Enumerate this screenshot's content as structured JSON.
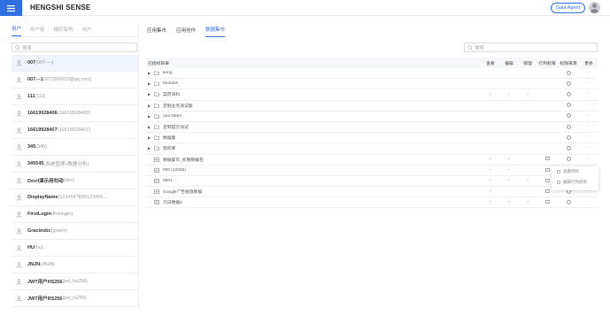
{
  "header": {
    "brand": "HENGSHI SENSE",
    "agent_button": "Data Agent",
    "menu_icon": "hamburger-menu-icon",
    "avatar_icon": "user-avatar-icon"
  },
  "left_panel": {
    "tabs": [
      {
        "label": "用户",
        "active": true
      },
      {
        "label": "用户组",
        "active": false
      },
      {
        "label": "组织架构",
        "active": false
      },
      {
        "label": "用户",
        "active": false
      }
    ],
    "search_placeholder": "搜索",
    "users": [
      {
        "name": "007",
        "id": "(007----)",
        "selected": true
      },
      {
        "name": "007---1",
        "id": "(977399912@qq.com)",
        "selected": false
      },
      {
        "name": "111",
        "id": "(111)",
        "selected": false
      },
      {
        "name": "16619928406",
        "id": "(16619928406)",
        "selected": false
      },
      {
        "name": "16619928407",
        "id": "(16619928407)",
        "selected": false
      },
      {
        "name": "345",
        "id": "(345)",
        "selected": false
      },
      {
        "name": "345545",
        "id": "(系统管理+数据分析)",
        "selected": false
      },
      {
        "name": "Devil演示用勿动",
        "id": "(dev)",
        "selected": false
      },
      {
        "name": "DisplayName",
        "id": "(1234567890123456…",
        "selected": false
      },
      {
        "name": "FirstLogin",
        "id": "(firstlogin)",
        "selected": false
      },
      {
        "name": "Graciesbc",
        "id": "(gracie)",
        "selected": false
      },
      {
        "name": "HU",
        "id": "(hu)",
        "selected": false
      },
      {
        "name": "JNJN",
        "id": "(JNJN)",
        "selected": false
      },
      {
        "name": "JWT用户HS256",
        "id": "(jwt_hs256)",
        "selected": false
      },
      {
        "name": "JWT用户RS256",
        "id": "(jwt_rs256)",
        "selected": false
      }
    ]
  },
  "right_panel": {
    "tabs": [
      {
        "label": "应用集市",
        "active": false
      },
      {
        "label": "应用创作",
        "active": false
      },
      {
        "label": "数据集市",
        "active": true
      }
    ],
    "search_placeholder": "搜索",
    "columns": {
      "name": "已授权目录",
      "view": "查看",
      "edit": "编辑",
      "manage": "管理",
      "row_perm": "行列权限",
      "source": "权限来源",
      "more": "更多"
    },
    "rows": [
      {
        "name": "kong",
        "folder": true,
        "expand": true,
        "view": false,
        "edit": false,
        "manage": false,
        "row_perm": false
      },
      {
        "name": "Mundoll",
        "folder": true,
        "expand": true,
        "view": false,
        "edit": false,
        "manage": false,
        "row_perm": false
      },
      {
        "name": "菜药资料",
        "folder": true,
        "expand": true,
        "view": true,
        "edit": true,
        "manage": true,
        "row_perm": false
      },
      {
        "name": "定制业务测试集",
        "folder": true,
        "expand": true,
        "view": false,
        "edit": false,
        "manage": false,
        "row_perm": false
      },
      {
        "name": "una folder",
        "folder": true,
        "expand": true,
        "view": false,
        "edit": false,
        "manage": false,
        "row_perm": false
      },
      {
        "name": "定制提示测试",
        "folder": true,
        "expand": true,
        "view": false,
        "edit": false,
        "manage": false,
        "row_perm": false
      },
      {
        "name": "数据集",
        "folder": true,
        "expand": true,
        "view": false,
        "edit": false,
        "manage": false,
        "row_perm": false
      },
      {
        "name": "我的库",
        "folder": true,
        "expand": true,
        "view": false,
        "edit": false,
        "manage": false,
        "row_perm": false
      },
      {
        "name": "数据集市_权限数据包",
        "folder": false,
        "expand": false,
        "view": true,
        "edit": true,
        "manage": false,
        "row_perm": true
      },
      {
        "name": "000 (12345)",
        "folder": false,
        "expand": false,
        "view": true,
        "edit": true,
        "manage": false,
        "row_perm": true
      },
      {
        "name": "0001",
        "folder": false,
        "expand": false,
        "view": true,
        "edit": true,
        "manage": true,
        "row_perm": true
      },
      {
        "name": "Google广告投放数据",
        "folder": false,
        "expand": false,
        "view": true,
        "edit": false,
        "manage": false,
        "row_perm": true
      },
      {
        "name": "元日数据2",
        "folder": false,
        "expand": false,
        "view": true,
        "edit": true,
        "manage": true,
        "row_perm": true
      }
    ],
    "popup": {
      "items": [
        "查看授权",
        "编辑行列权限"
      ]
    }
  }
}
